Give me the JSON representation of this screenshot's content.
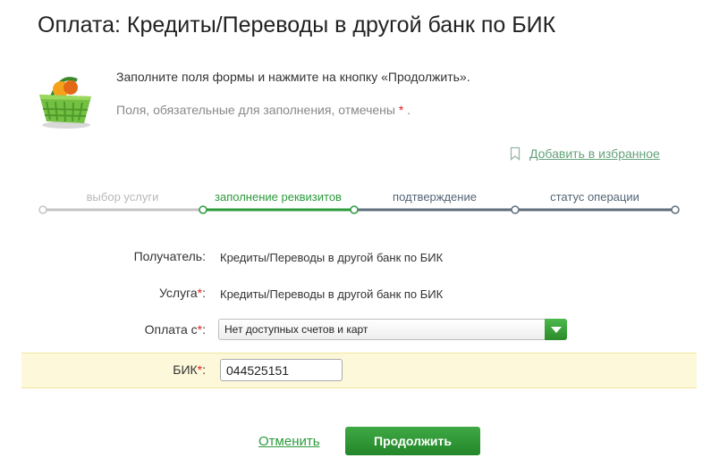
{
  "page": {
    "title": "Оплата: Кредиты/Переводы в другой банк по БИК",
    "info_line1": "Заполните поля формы и нажмите на кнопку «Продолжить».",
    "info_line2": "Поля, обязательные для заполнения, отмечены",
    "required_mark": "*",
    "info_line2_end": "."
  },
  "favorites": {
    "label": "Добавить в избранное",
    "icon": "bookmark-icon"
  },
  "steps": [
    {
      "label": "выбор услуги",
      "state": "done"
    },
    {
      "label": "заполнение реквизитов",
      "state": "active"
    },
    {
      "label": "подтверждение",
      "state": "pending"
    },
    {
      "label": "статус операции",
      "state": "pending"
    }
  ],
  "form": {
    "recipient": {
      "label": "Получатель:",
      "value": "Кредиты/Переводы в другой банк по БИК"
    },
    "service": {
      "label": "Услуга",
      "required": "*",
      "suffix": ":",
      "value": "Кредиты/Переводы в другой банк по БИК"
    },
    "pay_from": {
      "label": "Оплата с",
      "required": "*",
      "suffix": ":",
      "selected": "Нет доступных счетов и карт"
    },
    "bik": {
      "label": "БИК",
      "required": "*",
      "suffix": ":",
      "value": "044525151"
    }
  },
  "actions": {
    "cancel": "Отменить",
    "continue": "Продолжить"
  },
  "colors": {
    "accent_green": "#2c9b3c",
    "progress_done": "#c4c4c4",
    "progress_pending": "#5e6e7c",
    "highlight_band": "#fdf8da"
  }
}
